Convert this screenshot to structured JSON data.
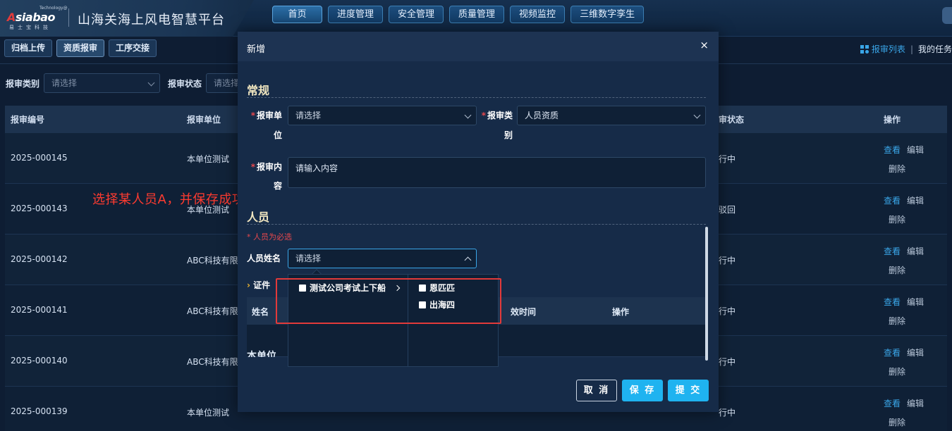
{
  "header": {
    "logo_tech": "Technology@",
    "logo_mark_a": "A",
    "logo_mark_rest": "siabao",
    "logo_cn": "易士宝科技",
    "app_title": "山海关海上风电智慧平台",
    "nav": [
      "首页",
      "进度管理",
      "安全管理",
      "质量管理",
      "视频监控",
      "三维数字孪生"
    ]
  },
  "subtabs": [
    "归档上传",
    "资质报审",
    "工序交接"
  ],
  "toolbar": {
    "list_link": "报审列表",
    "separator": "|",
    "my_tasks": "我的任务"
  },
  "filters": {
    "type_label": "报审类别",
    "type_placeholder": "请选择",
    "status_label": "报审状态",
    "status_placeholder": "请选择"
  },
  "table": {
    "headers": {
      "no": "报审编号",
      "unit": "报审单位",
      "status": "审状态",
      "ops": "操作"
    },
    "rows": [
      {
        "no": "2025-000145",
        "unit": "本单位测试",
        "status": "行中"
      },
      {
        "no": "2025-000143",
        "unit": "本单位测试",
        "status": "驳回"
      },
      {
        "no": "2025-000142",
        "unit": "ABC科技有限",
        "status": "行中"
      },
      {
        "no": "2025-000141",
        "unit": "ABC科技有限",
        "status": "行中"
      },
      {
        "no": "2025-000140",
        "unit": "ABC科技有限",
        "status": "行中"
      },
      {
        "no": "2025-000139",
        "unit": "本单位测试",
        "status": "行中"
      }
    ],
    "op_view": "查看",
    "op_edit": "编辑",
    "op_delete": "删除"
  },
  "modal": {
    "title": "新增",
    "close": "×",
    "section_general": "常规",
    "unit_label_1": "报审单",
    "unit_label_2": "位",
    "unit_placeholder": "请选择",
    "type_label_1": "报审类",
    "type_label_2": "别",
    "type_value": "人员资质",
    "content_label_1": "报审内",
    "content_label_2": "容",
    "content_placeholder": "请输入内容",
    "section_person": "人员",
    "required_note": "* 人员为必选",
    "person_label": "人员姓名",
    "person_placeholder": "请选择",
    "cert_label": "证件",
    "sub_headers": {
      "name": "姓名",
      "valid_time": "效时间",
      "ops": "操作"
    },
    "partial_text": "本单位",
    "buttons": {
      "cancel": "取 消",
      "save": "保 存",
      "submit": "提 交"
    }
  },
  "cascader": {
    "col1": [
      {
        "label": "测试公司考试上下船",
        "has_children": true
      }
    ],
    "col2": [
      {
        "label": "恩匹匹"
      },
      {
        "label": "出海四"
      }
    ]
  },
  "annotation": "选择某人员A，并保存成功，删除该条信息，再次新增（人员资质）时，选择人员中却没有（人员A）",
  "colors": {
    "accent": "#1fb3f0",
    "link": "#3aa6e8",
    "annotation": "#ff3b30",
    "required": "#e5484d"
  }
}
